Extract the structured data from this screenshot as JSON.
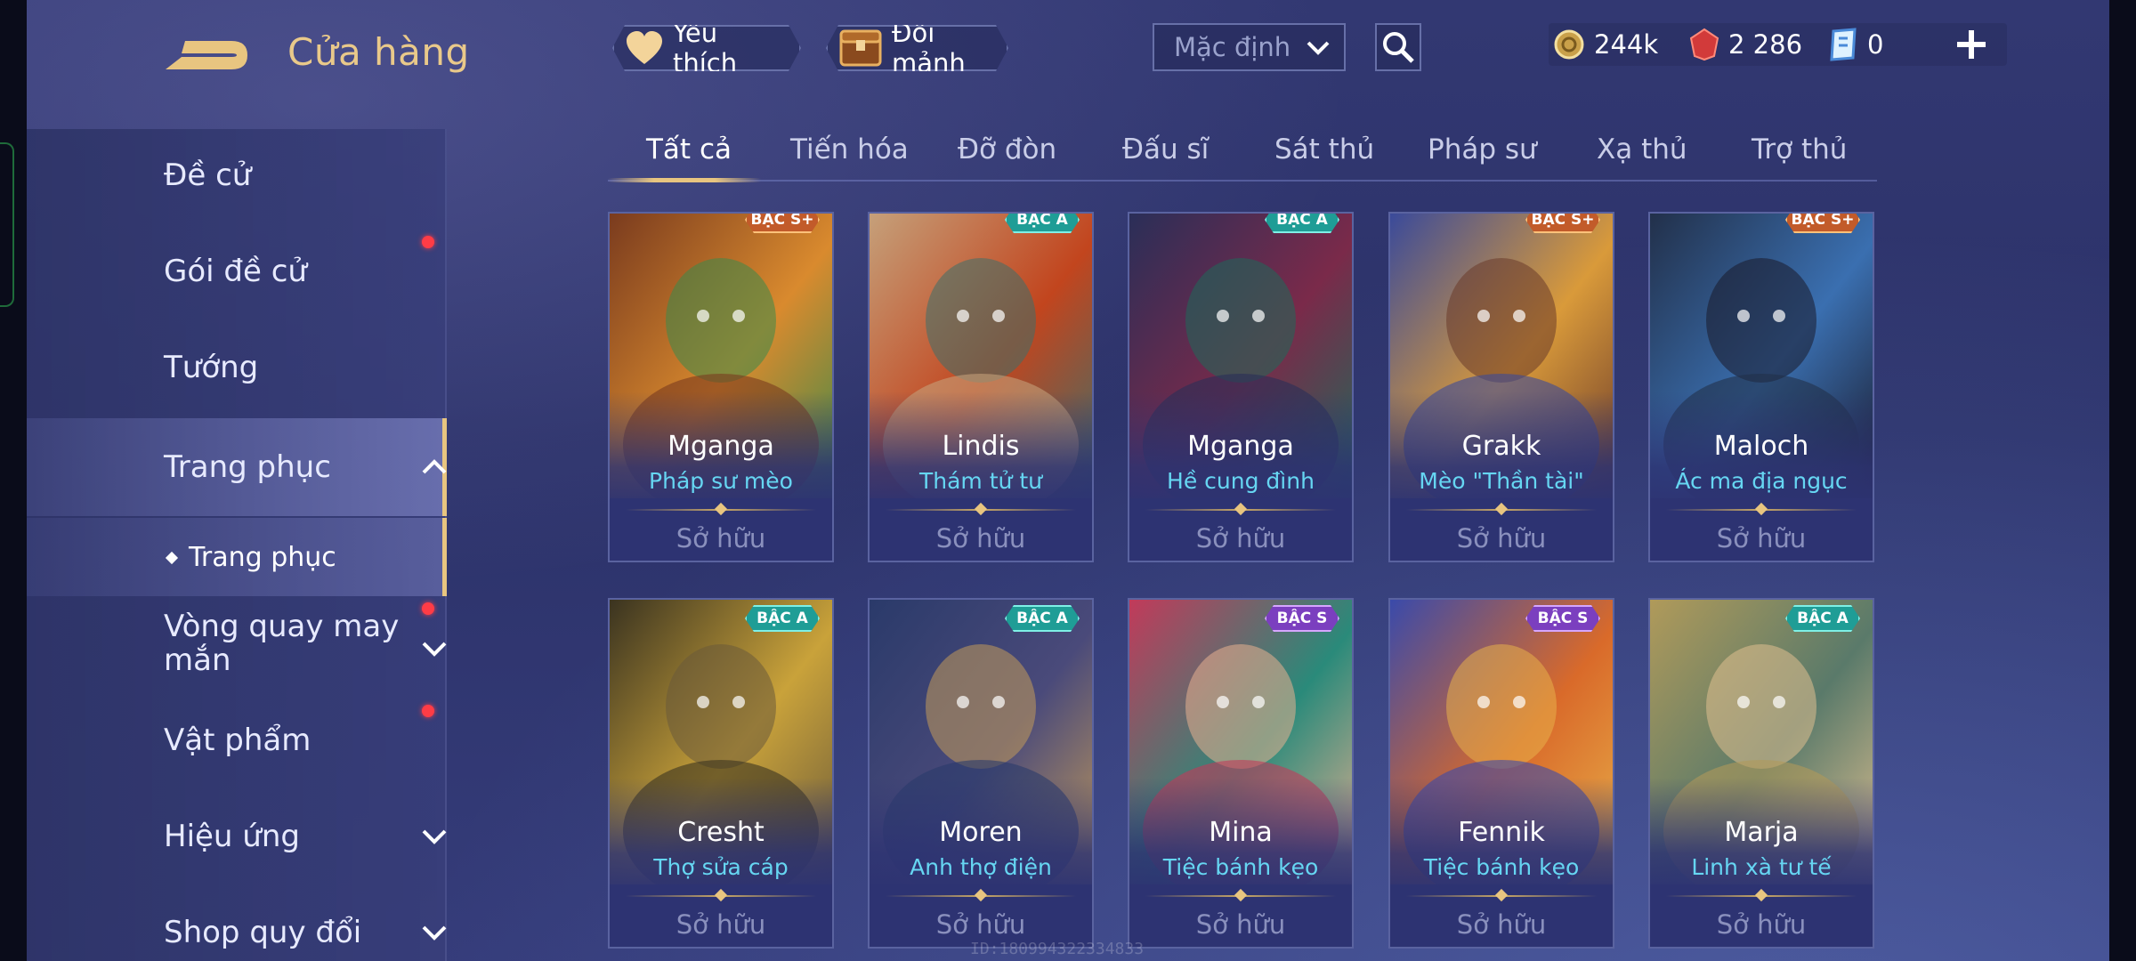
{
  "header": {
    "title": "Cửa hàng",
    "favorite_label": "Yêu thích",
    "exchange_label": "Đổi mảnh",
    "sort_value": "Mặc định"
  },
  "currency": {
    "gold": "244k",
    "ruby": "2 286",
    "voucher": "0"
  },
  "sidebar": {
    "items": [
      {
        "label": "Đề cử",
        "dot": false
      },
      {
        "label": "Gói đề cử",
        "dot": true
      },
      {
        "label": "Tướng",
        "dot": false
      },
      {
        "label": "Trang phục",
        "active": true
      },
      {
        "label": "Vòng quay may mắn",
        "dot": true
      },
      {
        "label": "Vật phẩm",
        "dot": true
      },
      {
        "label": "Hiệu ứng",
        "dot": false
      },
      {
        "label": "Shop quy đổi",
        "dot": false
      }
    ],
    "sub_item": "Trang phục"
  },
  "tabs": [
    "Tất cả",
    "Tiến hóa",
    "Đỡ đòn",
    "Đấu sĩ",
    "Sát thủ",
    "Pháp sư",
    "Xạ thủ",
    "Trợ thủ"
  ],
  "active_tab": "Tất cả",
  "cards": [
    {
      "hero": "Mganga",
      "skin": "Pháp sư mèo",
      "badge": "BẬC S+",
      "status": "Sở hữu",
      "colors": [
        "#7a3b1e",
        "#d98a2e",
        "#3a8a4a"
      ]
    },
    {
      "hero": "Lindis",
      "skin": "Thám tử tư",
      "badge": "BẬC A",
      "status": "Sở hữu",
      "colors": [
        "#c5a07a",
        "#c2451e",
        "#3c6f6a"
      ]
    },
    {
      "hero": "Mganga",
      "skin": "Hề cung đình",
      "badge": "BẬC A",
      "status": "Sở hữu",
      "colors": [
        "#2a2e58",
        "#7a2a4a",
        "#1e6a5a"
      ]
    },
    {
      "hero": "Grakk",
      "skin": "Mèo \"Thần tài\"",
      "badge": "BẬC S+",
      "status": "Sở hữu",
      "colors": [
        "#3a4a9a",
        "#d99a3a",
        "#6a3a2a"
      ]
    },
    {
      "hero": "Maloch",
      "skin": "Ác ma địa ngục",
      "badge": "BẬC S+",
      "status": "Sở hữu",
      "colors": [
        "#22304a",
        "#3a6fb0",
        "#1a1a2a"
      ]
    },
    {
      "hero": "Cresht",
      "skin": "Thợ sửa cáp",
      "badge": "BẬC A",
      "status": "Sở hữu",
      "colors": [
        "#3a3320",
        "#c9a23a",
        "#6a5a3a"
      ]
    },
    {
      "hero": "Moren",
      "skin": "Anh thợ điện",
      "badge": "BẬC A",
      "status": "Sở hữu",
      "colors": [
        "#2a3a6a",
        "#4a4a7a",
        "#c29a5a"
      ]
    },
    {
      "hero": "Mina",
      "skin": "Tiệc bánh kẹo",
      "badge": "BẬC S",
      "status": "Sở hữu",
      "colors": [
        "#c23a5a",
        "#2a8a7a",
        "#e8b090"
      ]
    },
    {
      "hero": "Fennik",
      "skin": "Tiệc bánh kẹo",
      "badge": "BẬC S",
      "status": "Sở hữu",
      "colors": [
        "#3a4aaa",
        "#d96a2a",
        "#e8b04a"
      ]
    },
    {
      "hero": "Marja",
      "skin": "Linh xà tư tế",
      "badge": "BẬC A",
      "status": "Sở hữu",
      "colors": [
        "#b09a5a",
        "#5a7a6a",
        "#e0c090"
      ]
    }
  ],
  "watermark": "ID:180994322334833"
}
